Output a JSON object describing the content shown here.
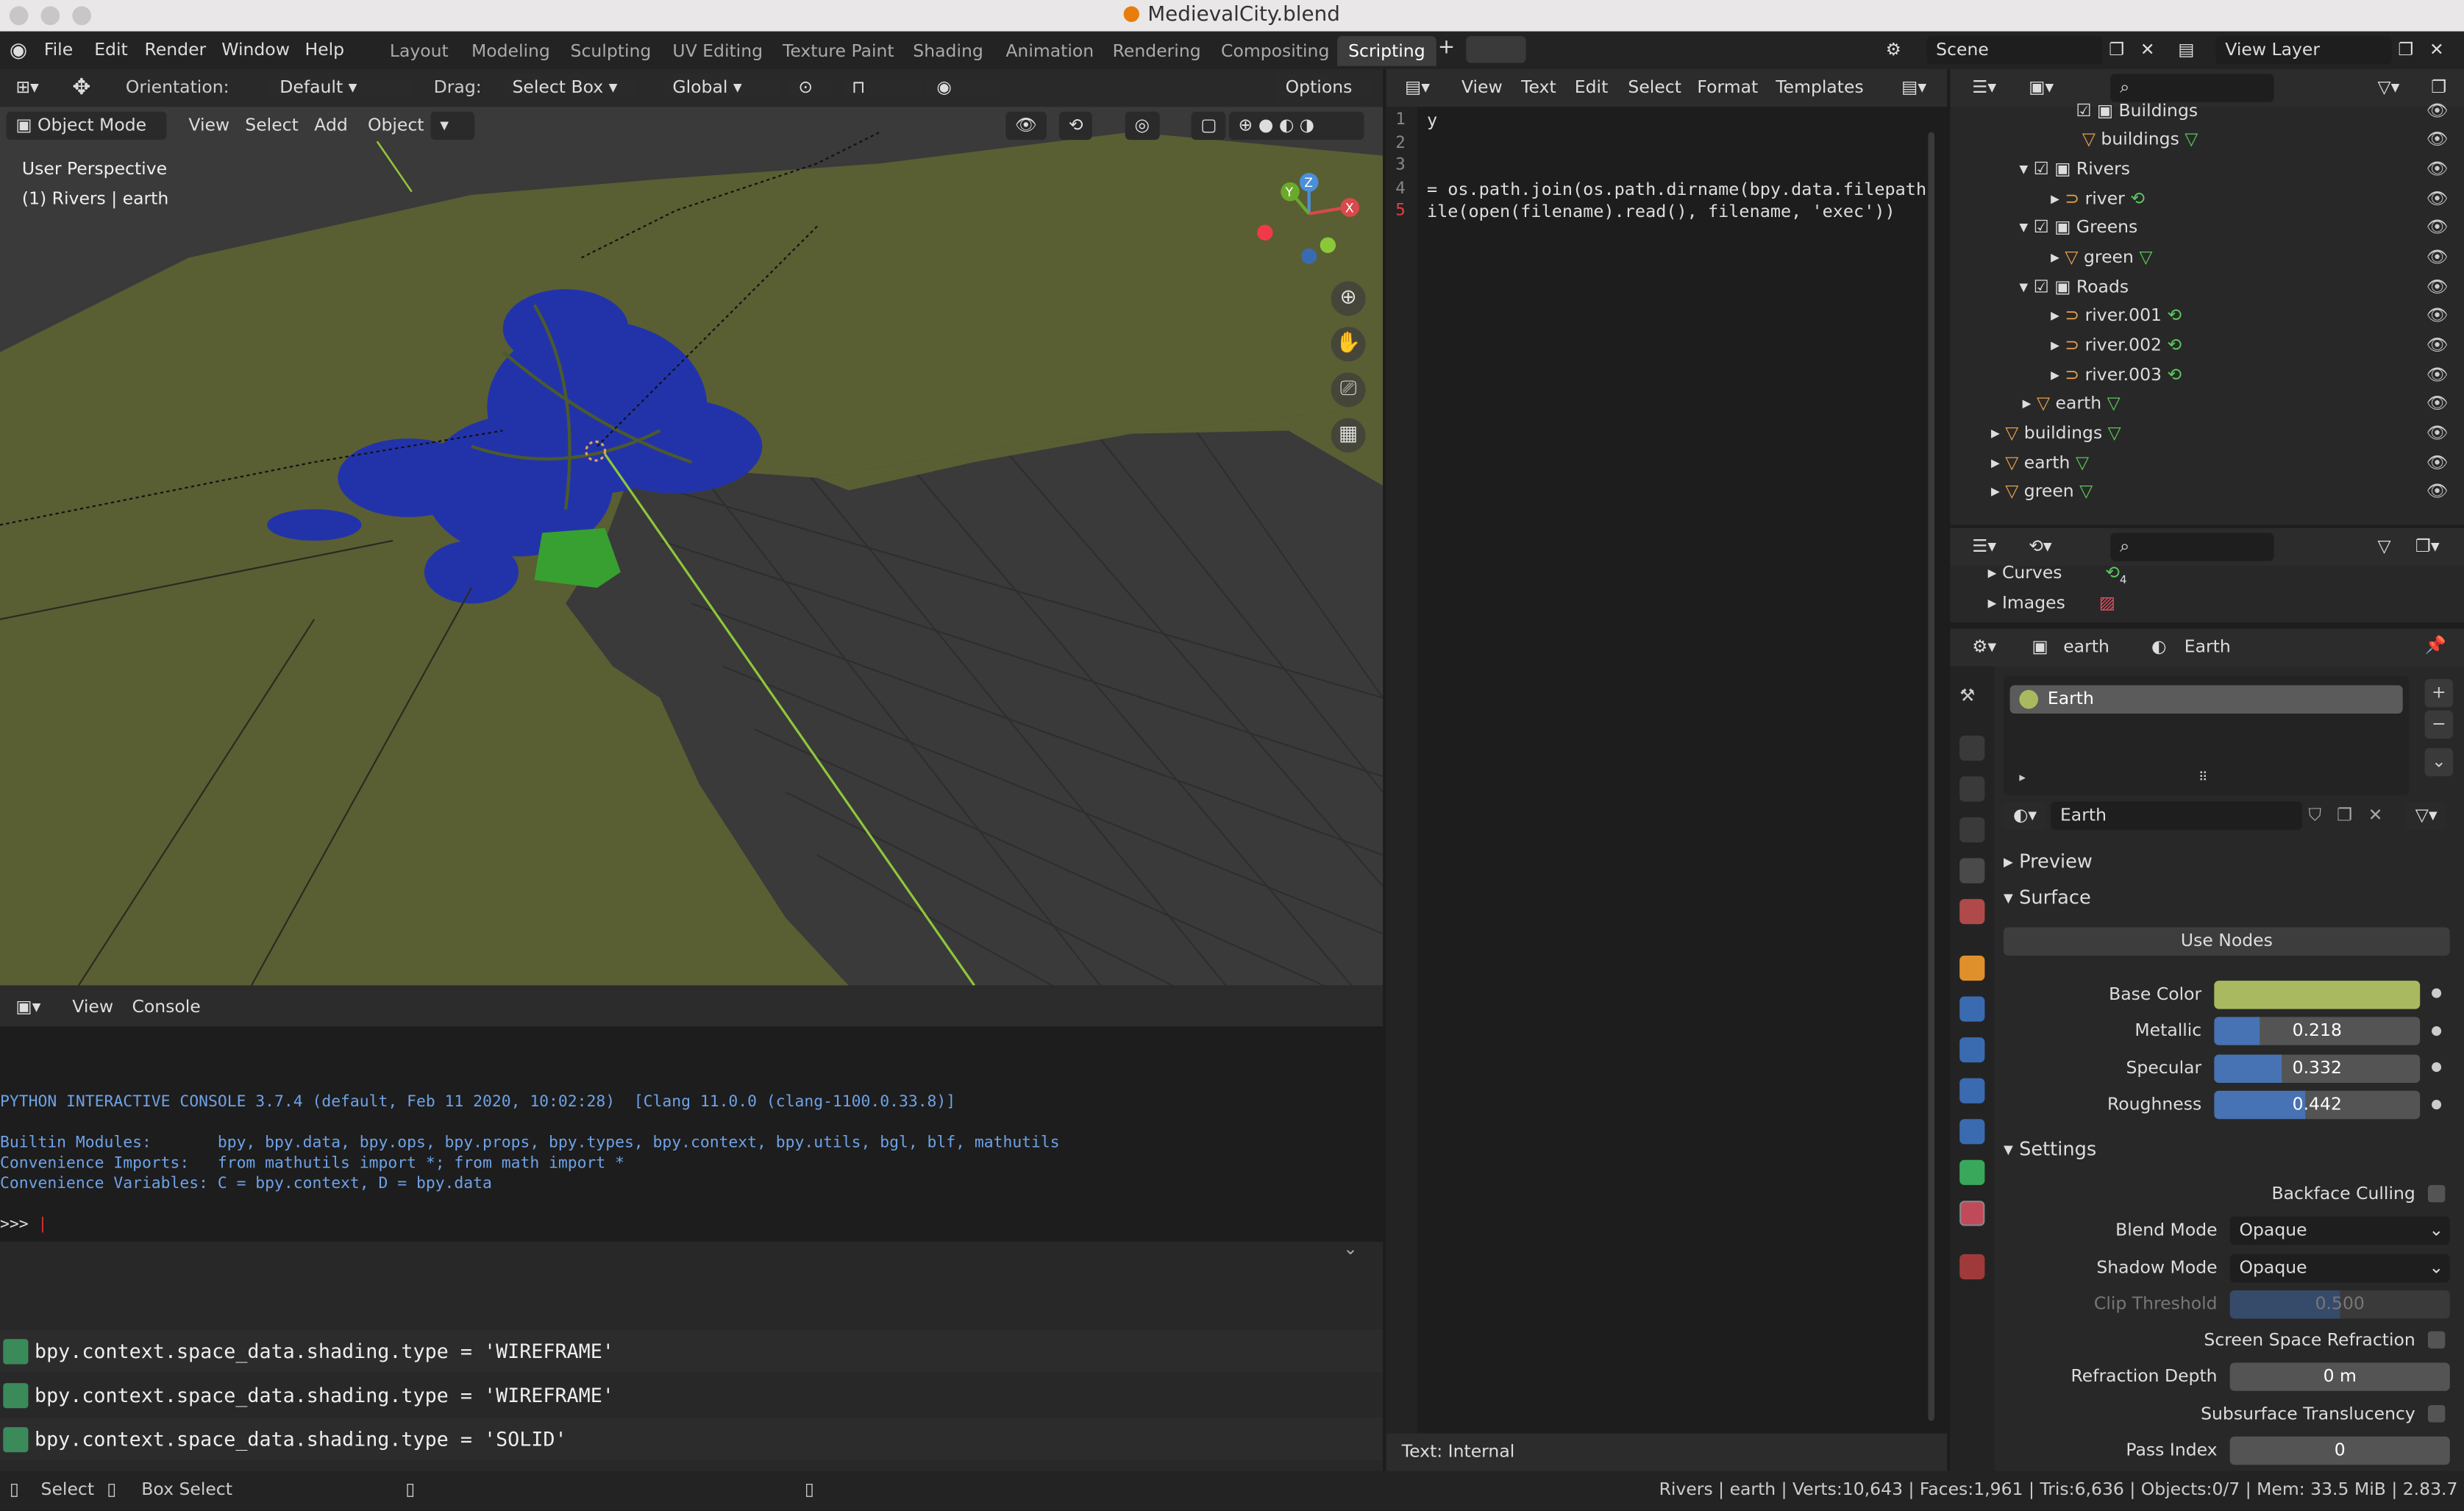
{
  "window": {
    "title": "MedievalCity.blend"
  },
  "menu": [
    "File",
    "Edit",
    "Render",
    "Window",
    "Help"
  ],
  "workspaces": [
    "Layout",
    "Modeling",
    "Sculpting",
    "UV Editing",
    "Texture Paint",
    "Shading",
    "Animation",
    "Rendering",
    "Compositing",
    "Scripting"
  ],
  "active_workspace": "Scripting",
  "scene": {
    "label": "Scene",
    "view_layer": "View Layer"
  },
  "viewport": {
    "orientation_label": "Orientation:",
    "orientation_value": "Default",
    "drag_label": "Drag:",
    "drag_value": "Select Box",
    "transform": "Global",
    "options": "Options",
    "mode": "Object Mode",
    "menus": [
      "View",
      "Select",
      "Add",
      "Object"
    ],
    "overlay_title": "User Perspective",
    "overlay_sub": "(1) Rivers | earth",
    "gizmo": {
      "x": "X",
      "y": "Y",
      "z": "Z"
    },
    "colors": {
      "ground": "#5a5e33",
      "grid": "#3a3a3a",
      "buildings": "#2233aa"
    }
  },
  "console": {
    "menus": [
      "View",
      "Console"
    ],
    "lines": [
      "PYTHON INTERACTIVE CONSOLE 3.7.4 (default, Feb 11 2020, 10:02:28)  [Clang 11.0.0 (clang-1100.0.33.8)]",
      "",
      "Builtin Modules:       bpy, bpy.data, bpy.ops, bpy.props, bpy.types, bpy.context, bpy.utils, bgl, blf, mathutils",
      "Convenience Imports:   from mathutils import *; from math import *",
      "Convenience Variables: C = bpy.context, D = bpy.data"
    ],
    "prompt": ">>> "
  },
  "info": {
    "lines": [
      "bpy.context.space_data.shading.type = 'WIREFRAME'",
      "bpy.context.space_data.shading.type = 'WIREFRAME'",
      "bpy.context.space_data.shading.type = 'SOLID'"
    ]
  },
  "text_editor": {
    "menus": [
      "View",
      "Text",
      "Edit",
      "Select",
      "Format",
      "Templates"
    ],
    "line_numbers": [
      "1",
      "2",
      "3",
      "4",
      "5"
    ],
    "code": [
      "y",
      "",
      "",
      "= os.path.join(os.path.dirname(bpy.data.filepath)",
      "ile(open(filename).read(), filename, 'exec'))"
    ],
    "footer": "Text: Internal"
  },
  "outliner": {
    "rows": [
      {
        "label": "Buildings",
        "indent": 2
      },
      {
        "label": "buildings",
        "indent": 3
      },
      {
        "label": "Rivers",
        "indent": 2
      },
      {
        "label": "river",
        "indent": 3
      },
      {
        "label": "Greens",
        "indent": 2
      },
      {
        "label": "green",
        "indent": 3
      },
      {
        "label": "Roads",
        "indent": 2
      },
      {
        "label": "river.001",
        "indent": 3
      },
      {
        "label": "river.002",
        "indent": 3
      },
      {
        "label": "river.003",
        "indent": 3
      },
      {
        "label": "earth",
        "indent": 2
      },
      {
        "label": "buildings",
        "indent": 1
      },
      {
        "label": "earth",
        "indent": 1
      },
      {
        "label": "green",
        "indent": 1
      }
    ]
  },
  "data_browser": {
    "rows": [
      "Curves",
      "Images"
    ],
    "curves_count": "4"
  },
  "properties": {
    "object": "earth",
    "material": "Earth",
    "slot": "Earth",
    "material_field": "Earth",
    "sections": {
      "preview": "Preview",
      "surface": "Surface",
      "settings": "Settings"
    },
    "use_nodes": "Use Nodes",
    "base_color_label": "Base Color",
    "base_color": "#a9b960",
    "sliders": [
      {
        "label": "Metallic",
        "value": "0.218",
        "fraction": 0.218
      },
      {
        "label": "Specular",
        "value": "0.332",
        "fraction": 0.332
      },
      {
        "label": "Roughness",
        "value": "0.442",
        "fraction": 0.442
      }
    ],
    "backface_culling": "Backface Culling",
    "blend_mode_label": "Blend Mode",
    "blend_mode": "Opaque",
    "shadow_mode_label": "Shadow Mode",
    "shadow_mode": "Opaque",
    "clip_threshold_label": "Clip Threshold",
    "clip_threshold": "0.500",
    "ssr": "Screen Space Refraction",
    "refraction_depth_label": "Refraction Depth",
    "refraction_depth": "0 m",
    "subsurface": "Subsurface Translucency",
    "pass_index_label": "Pass Index",
    "pass_index": "0"
  },
  "status": {
    "select": "Select",
    "box_select": "Box Select",
    "stats": "Rivers | earth | Verts:10,643 | Faces:1,961 | Tris:6,636 | Objects:0/7 | Mem: 33.5 MiB | 2.83.7"
  }
}
